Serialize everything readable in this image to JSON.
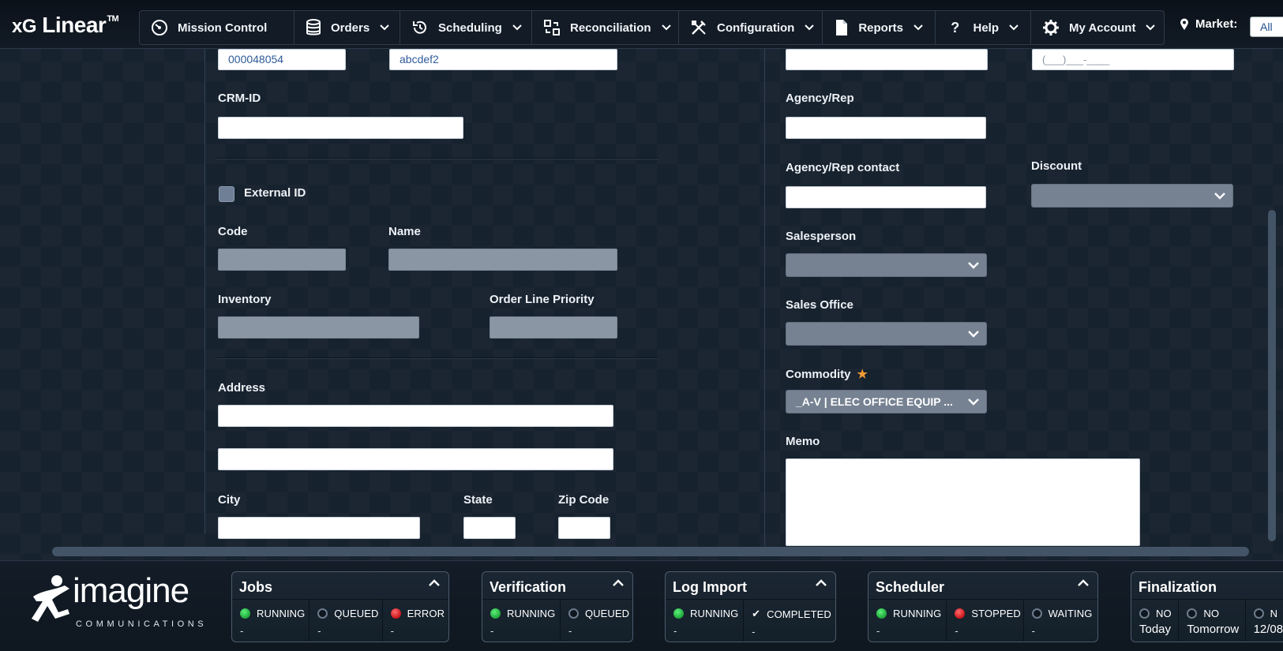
{
  "header": {
    "brand": "xG Linear",
    "brand_prefix": "xG",
    "brand_name": "Linear",
    "brand_tm": "TM",
    "nav": [
      {
        "label": "Mission Control",
        "icon": "gauge-icon"
      },
      {
        "label": "Orders",
        "icon": "database-icon"
      },
      {
        "label": "Scheduling",
        "icon": "history-icon"
      },
      {
        "label": "Reconciliation",
        "icon": "reconcile-icon"
      },
      {
        "label": "Configuration",
        "icon": "tools-icon"
      },
      {
        "label": "Reports",
        "icon": "document-icon"
      },
      {
        "label": "Help",
        "icon": "question-icon"
      },
      {
        "label": "My Account",
        "icon": "gear-icon"
      }
    ],
    "market_label": "Market:",
    "market_value": "All"
  },
  "form": {
    "left": {
      "top_field_1": "000048054",
      "top_field_2": "abcdef2",
      "crm_id_label": "CRM-ID",
      "crm_id_value": "",
      "external_id_label": "External ID",
      "code_label": "Code",
      "name_label": "Name",
      "inventory_label": "Inventory",
      "order_line_priority_label": "Order Line Priority",
      "address_label": "Address",
      "address_line1": "",
      "address_line2": "",
      "city_label": "City",
      "state_label": "State",
      "zip_label": "Zip Code"
    },
    "right": {
      "top_field_1": "",
      "phone_placeholder": "(___)___-____",
      "agency_rep_label": "Agency/Rep",
      "agency_rep_contact_label": "Agency/Rep contact",
      "discount_label": "Discount",
      "salesperson_label": "Salesperson",
      "sales_office_label": "Sales Office",
      "commodity_label": "Commodity",
      "commodity_required": "★",
      "commodity_value": "_A-V | ELEC OFFICE EQUIP ...",
      "memo_label": "Memo"
    }
  },
  "footer": {
    "logo_word": "imagine",
    "logo_sub": "COMMUNICATIONS",
    "panels": {
      "jobs": {
        "title": "Jobs",
        "cells": [
          {
            "status": "RUNNING",
            "color": "green",
            "count": "-"
          },
          {
            "status": "QUEUED",
            "color": "gray",
            "count": "-"
          },
          {
            "status": "ERROR",
            "color": "red",
            "count": "-"
          }
        ]
      },
      "verification": {
        "title": "Verification",
        "cells": [
          {
            "status": "RUNNING",
            "color": "green",
            "count": "-"
          },
          {
            "status": "QUEUED",
            "color": "gray",
            "count": "-"
          }
        ]
      },
      "log_import": {
        "title": "Log Import",
        "cells": [
          {
            "status": "RUNNING",
            "color": "green",
            "count": "-"
          },
          {
            "status": "COMPLETED",
            "color": "check",
            "count": "-"
          }
        ]
      },
      "scheduler": {
        "title": "Scheduler",
        "cells": [
          {
            "status": "RUNNING",
            "color": "green",
            "count": "-"
          },
          {
            "status": "STOPPED",
            "color": "red",
            "count": "-"
          },
          {
            "status": "WAITING",
            "color": "gray",
            "count": "-"
          }
        ]
      },
      "finalization": {
        "title": "Finalization",
        "cells": [
          {
            "status": "NO",
            "color": "gray",
            "count": "Today"
          },
          {
            "status": "NO",
            "color": "gray",
            "count": "Tomorrow"
          },
          {
            "status": "N",
            "color": "gray",
            "count": "12/08"
          }
        ]
      }
    }
  },
  "colors": {
    "background": "#17222f",
    "green": "#1ea53a",
    "red": "#c8141b",
    "required_star": "#f39c33",
    "link_text": "#2f5b9a"
  }
}
